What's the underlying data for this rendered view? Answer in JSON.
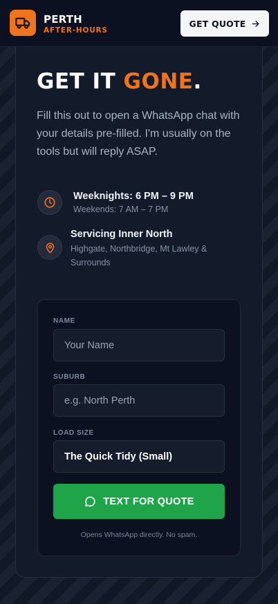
{
  "header": {
    "brand_name": "PERTH",
    "brand_sub": "AFTER-HOURS",
    "quote_button": "GET QUOTE",
    "logo_icon": "truck-icon",
    "quote_icon": "arrow-right-icon"
  },
  "hero": {
    "headline_a": "GET IT ",
    "headline_accent": "GONE",
    "headline_end": ".",
    "intro": "Fill this out to open a WhatsApp chat with your details pre-filled. I'm usually on the tools but will reply ASAP."
  },
  "info": {
    "hours": {
      "icon": "clock-icon",
      "title": "Weeknights: 6 PM – 9 PM",
      "subtitle": "Weekends: 7 AM – 7 PM"
    },
    "area": {
      "icon": "map-pin-icon",
      "title": "Servicing Inner North",
      "subtitle": "Highgate, Northbridge, Mt Lawley & Surrounds"
    }
  },
  "form": {
    "name_label": "NAME",
    "name_placeholder": "Your Name",
    "name_value": "",
    "suburb_label": "SUBURB",
    "suburb_placeholder": "e.g. North Perth",
    "suburb_value": "",
    "load_label": "LOAD SIZE",
    "load_value": "The Quick Tidy (Small)",
    "submit_label": "TEXT FOR QUOTE",
    "submit_icon": "whatsapp-icon",
    "footnote": "Opens WhatsApp directly. No spam."
  },
  "colors": {
    "accent": "#f0731e",
    "whatsapp_green": "#1fa44a",
    "background": "#0b1120"
  }
}
